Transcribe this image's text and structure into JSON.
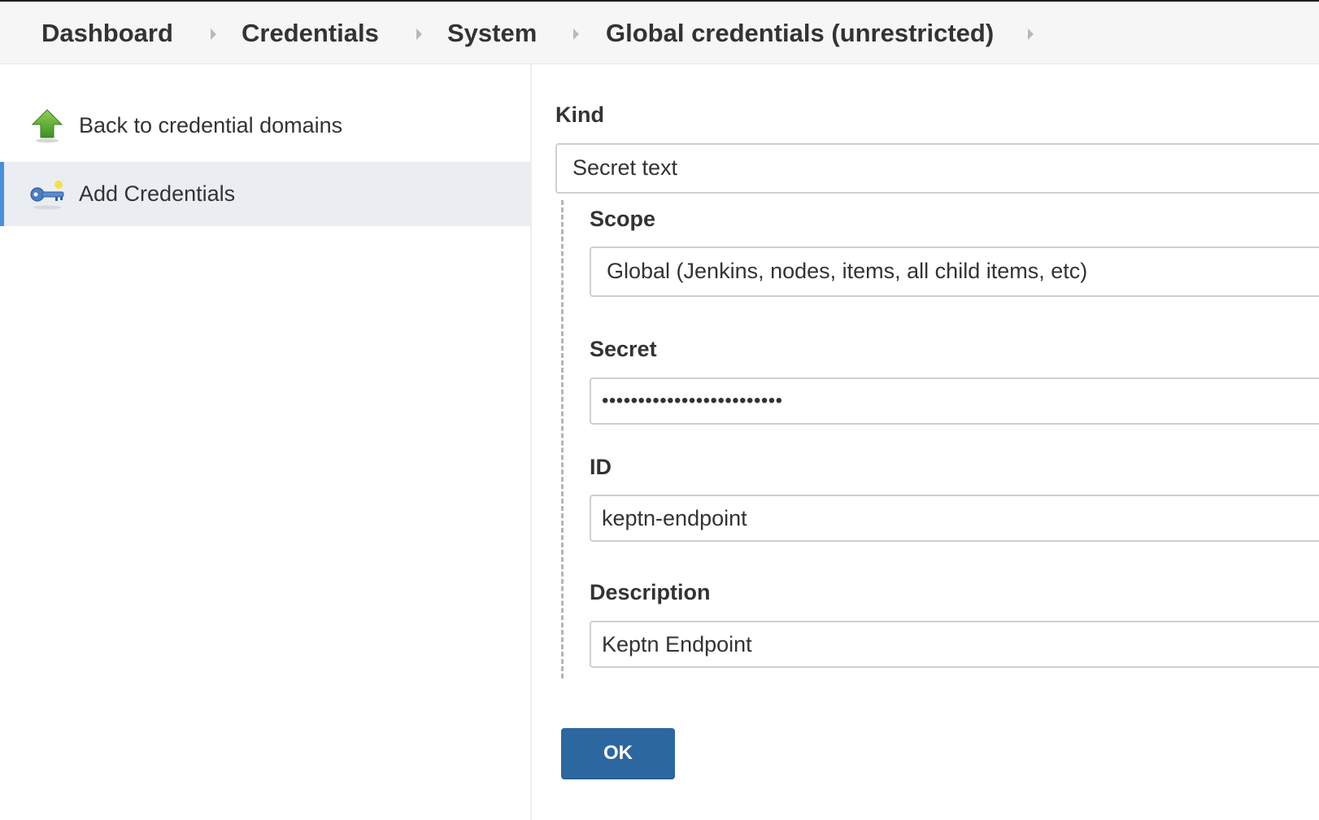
{
  "breadcrumb": {
    "items": [
      "Dashboard",
      "Credentials",
      "System",
      "Global credentials (unrestricted)"
    ]
  },
  "sidebar": {
    "items": [
      {
        "label": "Back to credential domains",
        "icon": "up-arrow-icon",
        "active": false
      },
      {
        "label": "Add Credentials",
        "icon": "key-icon",
        "active": true
      }
    ]
  },
  "form": {
    "kind": {
      "label": "Kind",
      "value": "Secret text"
    },
    "scope": {
      "label": "Scope",
      "value": "Global (Jenkins, nodes, items, all child items, etc)"
    },
    "secret": {
      "label": "Secret",
      "value": "•••••••••••••••••••••••••"
    },
    "id": {
      "label": "ID",
      "value": "keptn-endpoint"
    },
    "description": {
      "label": "Description",
      "value": "Keptn Endpoint"
    },
    "ok_label": "OK"
  },
  "colors": {
    "accent": "#4a90d9",
    "button": "#2c67a0",
    "active_bg": "#eaeef2",
    "breadcrumb_bg": "#f6f6f7"
  }
}
